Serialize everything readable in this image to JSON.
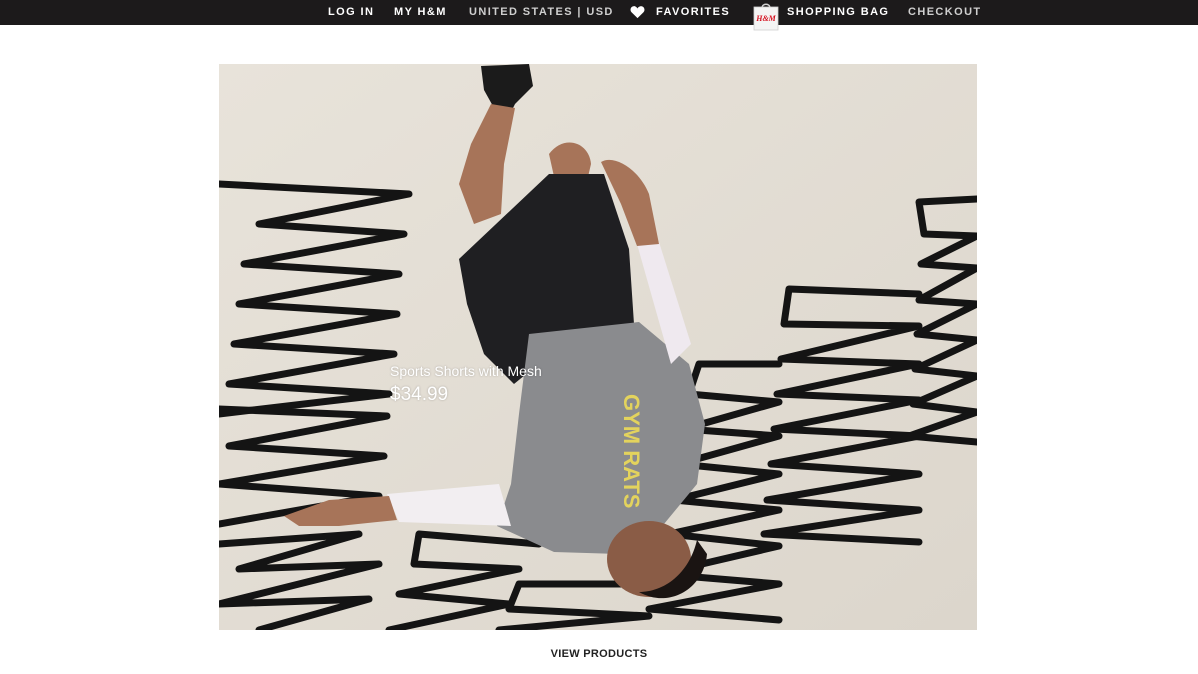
{
  "topbar": {
    "login_label": "LOG IN",
    "myhm_label": "MY H&M",
    "region_label": "UNITED STATES | USD",
    "favorites_label": "FAVORITES",
    "bag_brand": "H&M",
    "shopping_bag_label": "SHOPPING BAG",
    "checkout_label": "CHECKOUT",
    "background_color": "#1c1a1b"
  },
  "hero": {
    "product_name": "Sports Shorts with Mesh",
    "product_price": "$34.99",
    "shirt_print": "GYM RATS"
  },
  "footer_link": {
    "label": "VIEW PRODUCTS"
  },
  "icons": [
    "heart-icon",
    "shopping-bag-icon"
  ]
}
